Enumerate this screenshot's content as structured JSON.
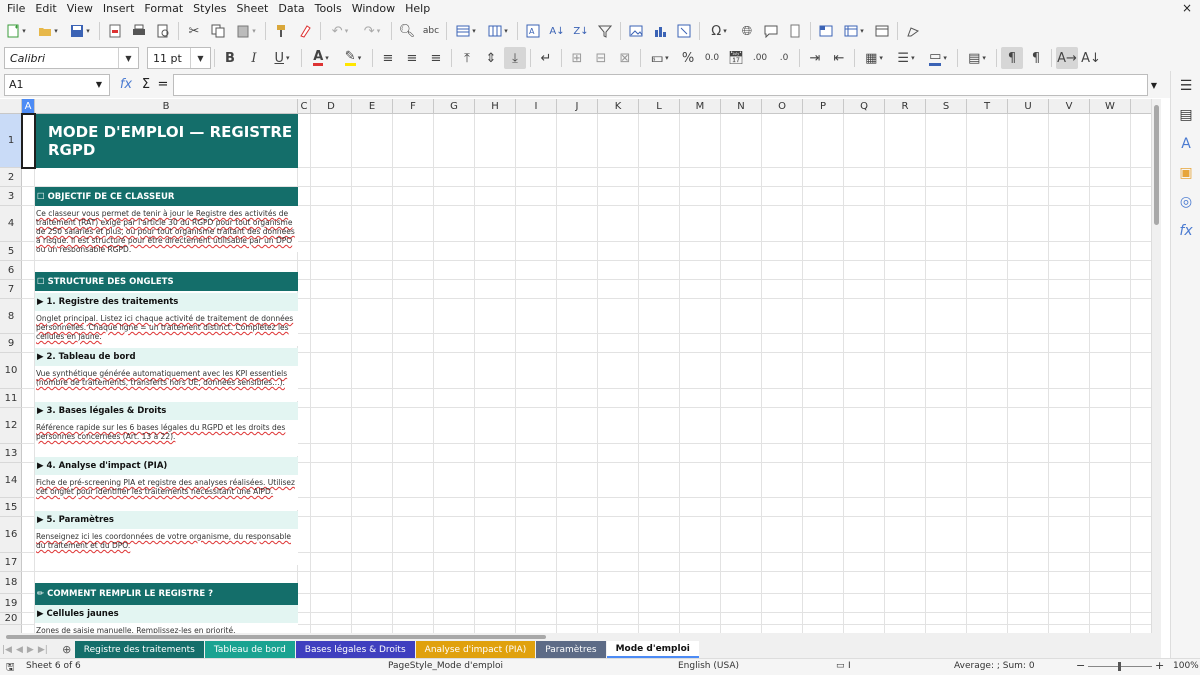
{
  "menu": [
    "File",
    "Edit",
    "View",
    "Insert",
    "Format",
    "Styles",
    "Sheet",
    "Data",
    "Tools",
    "Window",
    "Help"
  ],
  "window_close": "×",
  "toolbar": {
    "font_name": "Calibri",
    "font_size": "11 pt",
    "bold": "B",
    "italic": "I",
    "underline": "U",
    "percent": "%",
    "number_format": "0.0"
  },
  "formula_bar": {
    "name_box": "A1",
    "fx": "fx",
    "sum": "Σ",
    "equals": "=",
    "content": ""
  },
  "columns": [
    "A",
    "B",
    "C",
    "D",
    "E",
    "F",
    "G",
    "H",
    "I",
    "J",
    "K",
    "L",
    "M",
    "N",
    "O",
    "P",
    "Q",
    "R",
    "S",
    "T",
    "U",
    "V",
    "W"
  ],
  "rows": [
    "1",
    "2",
    "3",
    "4",
    "5",
    "6",
    "7",
    "8",
    "9",
    "10",
    "11",
    "12",
    "13",
    "14",
    "15",
    "16",
    "17",
    "18",
    "19",
    "20"
  ],
  "cells": {
    "title": "MODE D'EMPLOI — REGISTRE RGPD",
    "sec_objectif": "☐ OBJECTIF DE CE CLASSEUR",
    "objectif_text": "Ce classeur vous permet de tenir à jour le Registre des activités de traitement (RAT) exigé par l'article 30 du RGPD pour tout organisme de 250 salariés et plus, ou pour tout organisme traitant des données à risque. Il est structuré pour être directement utilisable par un DPO ou un responsable RGPD.",
    "sec_structure": "☐ STRUCTURE DES ONGLETS",
    "sub1": "▶  1. Registre des traitements",
    "txt1": "Onglet principal. Listez ici chaque activité de traitement de données personnelles. Chaque ligne = un traitement distinct. Complétez les cellules en jaune.",
    "sub2": "▶  2. Tableau de bord",
    "txt2": "Vue synthétique générée automatiquement avec les KPI essentiels (nombre de traitements, transferts hors UE, données sensibles…).",
    "sub3": "▶  3. Bases légales & Droits",
    "txt3": "Référence rapide sur les 6 bases légales du RGPD et les droits des personnes concernées (Art. 13 à 22).",
    "sub4": "▶  4. Analyse d'impact (PIA)",
    "txt4": "Fiche de pré-screening PIA et registre des analyses réalisées. Utilisez cet onglet pour identifier les traitements nécessitant une AIPD.",
    "sub5": "▶  5. Paramètres",
    "txt5": "Renseignez ici les coordonnées de votre organisme, du responsable du traitement et du DPO.",
    "sec_remplir": "✏ COMMENT REMPLIR LE REGISTRE ?",
    "sub_jaunes": "▶  Cellules jaunes",
    "txt_jaunes": "Zones de saisie manuelle. Remplissez-les en priorité."
  },
  "tabs": [
    {
      "label": "Registre des traitements",
      "color": "#146e6a"
    },
    {
      "label": "Tableau de bord",
      "color": "#1aa391"
    },
    {
      "label": "Bases légales & Droits",
      "color": "#3f3fbf"
    },
    {
      "label": "Analyse d'impact (PIA)",
      "color": "#e0a10d"
    },
    {
      "label": "Paramètres",
      "color": "#5d6b86"
    },
    {
      "label": "Mode d'emploi",
      "color": "#ffffff"
    }
  ],
  "status": {
    "sheet": "Sheet 6 of 6",
    "page_style": "PageStyle_Mode d'emploi",
    "language": "English (USA)",
    "summary": "Average: ; Sum: 0",
    "zoom": "100%",
    "zoom_level": 1.0
  },
  "colors": {
    "section_bg": "#146e6a",
    "subsection_bg": "#e3f5f2",
    "selection": "#4c8bf5"
  }
}
